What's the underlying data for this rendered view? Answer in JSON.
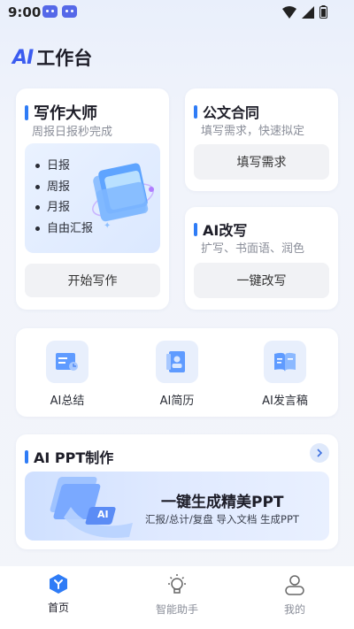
{
  "status_bar": {
    "time": "9:00"
  },
  "header": {
    "logo_text": "AI",
    "title": "工作台"
  },
  "writing_master": {
    "title": "写作大师",
    "subtitle": "周报日报秒完成",
    "items": [
      "日报",
      "周报",
      "月报",
      "自由汇报"
    ],
    "button_label": "开始写作"
  },
  "official_docs": {
    "title": "公文合同",
    "subtitle": "填写需求，快速拟定",
    "button_label": "填写需求"
  },
  "ai_rewrite": {
    "title": "AI改写",
    "subtitle": "扩写、书面语、润色",
    "button_label": "一键改写"
  },
  "quick_tools": [
    {
      "label": "AI总结",
      "icon": "summary-icon"
    },
    {
      "label": "AI简历",
      "icon": "resume-icon"
    },
    {
      "label": "AI发言稿",
      "icon": "speech-icon"
    }
  ],
  "ppt": {
    "title": "AI PPT制作",
    "banner_title": "一键生成精美PPT",
    "banner_subtitle": "汇报/总计/复盘 导入文档 生成PPT",
    "banner_badge": "AI"
  },
  "bottom_nav": [
    {
      "label": "首页",
      "icon": "home-icon",
      "active": true
    },
    {
      "label": "智能助手",
      "icon": "lightbulb-icon",
      "active": false
    },
    {
      "label": "我的",
      "icon": "profile-icon",
      "active": false
    }
  ],
  "colors": {
    "accent": "#2f7cf6",
    "brand": "#3b5cf0",
    "background": "#f3f5fa"
  }
}
